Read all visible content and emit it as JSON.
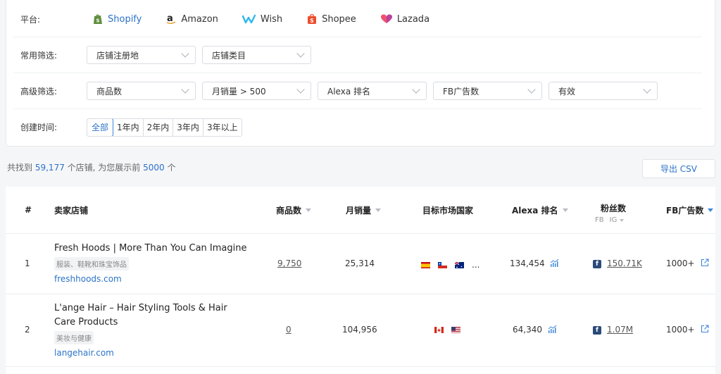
{
  "filters": {
    "platform_label": "平台:",
    "platforms": [
      {
        "name": "Shopify",
        "icon": "shopify-icon",
        "active": true
      },
      {
        "name": "Amazon",
        "icon": "amazon-icon",
        "active": false
      },
      {
        "name": "Wish",
        "icon": "wish-icon",
        "active": false
      },
      {
        "name": "Shopee",
        "icon": "shopee-icon",
        "active": false
      },
      {
        "name": "Lazada",
        "icon": "lazada-icon",
        "active": false
      }
    ],
    "common_label": "常用筛选:",
    "common": [
      "店铺注册地",
      "店铺类目"
    ],
    "advanced_label": "高级筛选:",
    "advanced": [
      "商品数",
      "月销量 > 500",
      "Alexa 排名",
      "FB广告数",
      "有效"
    ],
    "created_label": "创建时间:",
    "created_options": [
      "全部",
      "1年内",
      "2年内",
      "3年内",
      "3年以上"
    ],
    "created_selected": "全部"
  },
  "summary": {
    "prefix": "共找到",
    "total": "59,177",
    "middle": "个店铺, 为您展示前",
    "shown": "5000",
    "suffix": "个"
  },
  "export_label": "导出 CSV",
  "table": {
    "headers": {
      "rank": "#",
      "store": "卖家店铺",
      "products": "商品数",
      "monthly_sales": "月销量",
      "markets": "目标市场国家",
      "alexa": "Alexa 排名",
      "fans": "粉丝数",
      "fans_sub_fb": "FB",
      "fans_sub_ig": "IG",
      "fb_ads": "FB广告数"
    },
    "rows": [
      {
        "rank": "1",
        "name": "Fresh Hoods | More Than You Can Imagine",
        "name_lines": [
          "Fresh Hoods | More Than You Can Imagine"
        ],
        "category": "服装、鞋靴和珠宝饰品",
        "domain": "freshhoods.com",
        "products": "9,750",
        "monthly_sales": "25,314",
        "flags": [
          "es",
          "cl",
          "au"
        ],
        "more_flags": "...",
        "alexa": "134,454",
        "fans": "150.71K",
        "fb_ads": "1000+"
      },
      {
        "rank": "2",
        "name": "L'ange Hair – Hair Styling Tools & Hair Care Products",
        "name_lines": [
          "L'ange Hair – Hair Styling Tools & Hair",
          "Care Products"
        ],
        "category": "美妆与健康",
        "domain": "langehair.com",
        "products": "0",
        "monthly_sales": "104,956",
        "flags": [
          "ca",
          "us"
        ],
        "more_flags": "",
        "alexa": "64,340",
        "fans": "1.07M",
        "fb_ads": "1000+"
      }
    ]
  },
  "colors": {
    "accent": "#2b73c9",
    "shopify": "#5e8e3e",
    "amazon": "#222222",
    "wish": "#2fb7ec",
    "shopee": "#ee4d2d",
    "lazada": "#f0506e"
  }
}
